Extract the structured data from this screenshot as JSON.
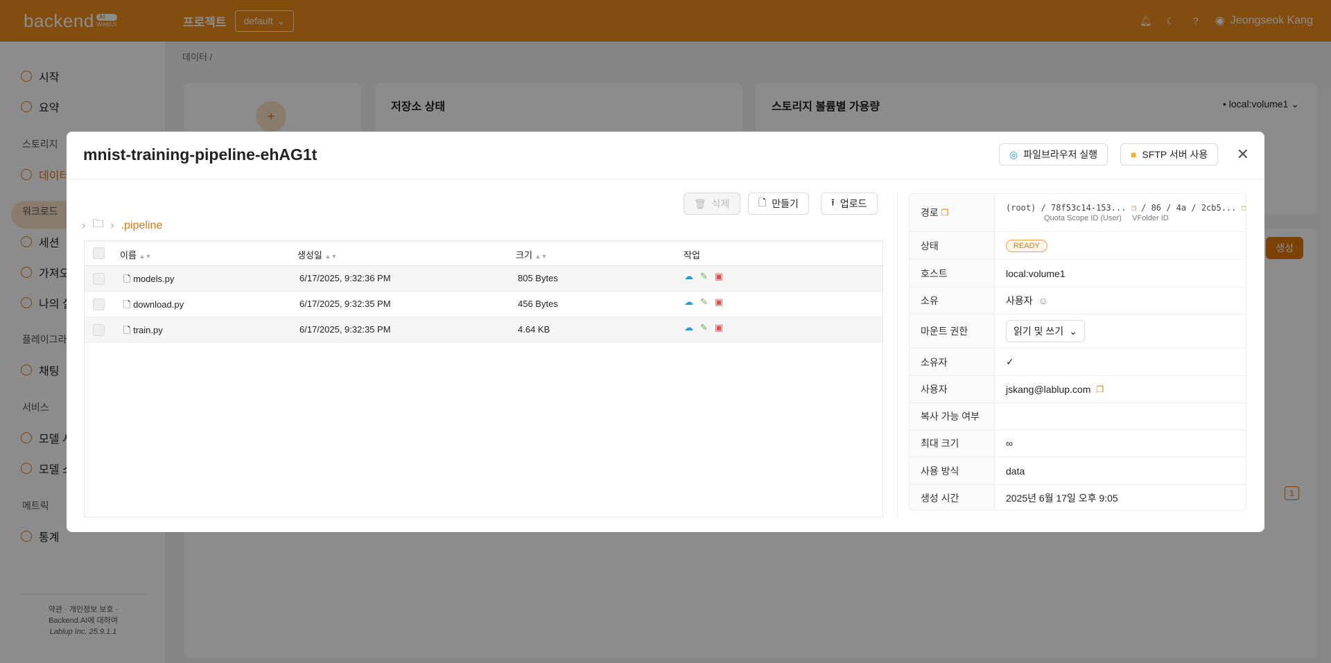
{
  "header": {
    "logo": "backend",
    "logo_ai": "AI",
    "logo_sub": "WebUI",
    "project_label": "프로젝트",
    "project_value": "default",
    "user_name": "Jeongseok Kang"
  },
  "sidebar": {
    "items": [
      {
        "label": "시작"
      },
      {
        "label": "요약"
      },
      {
        "label": "데이터"
      },
      {
        "label": "세션"
      },
      {
        "label": "가져오"
      },
      {
        "label": "나의 실"
      },
      {
        "label": "채팅"
      },
      {
        "label": "모델 서"
      },
      {
        "label": "모델 스"
      },
      {
        "label": "통계"
      }
    ],
    "sections": [
      "스토리지",
      "워크로드",
      "플레이그라",
      "서비스",
      "메트릭"
    ],
    "footer": {
      "line1": "약관 · 개인정보 보호 ·",
      "line2": "Backend.AI에 대하여",
      "line3": "Lablup Inc. 25.9.1.1"
    }
  },
  "main": {
    "breadcrumb": "데이터  /",
    "storage_status": "저장소 상태",
    "volume_title": "스토리지 볼륨별 가용량",
    "volume_sel": "local:volume1",
    "create_btn": "생성",
    "page": "1"
  },
  "modal": {
    "title": "mnist-training-pipeline-ehAG1t",
    "filebrowser_btn": "파일브라우저 실행",
    "sftp_btn": "SFTP 서버 사용",
    "toolbar": {
      "delete": "삭제",
      "create": "만들기",
      "upload": "업로드"
    },
    "path": ".pipeline",
    "columns": {
      "name": "이름",
      "created": "생성일",
      "size": "크기",
      "actions": "작업"
    },
    "files": [
      {
        "name": "models.py",
        "created": "6/17/2025, 9:32:36 PM",
        "size": "805 Bytes"
      },
      {
        "name": "download.py",
        "created": "6/17/2025, 9:32:35 PM",
        "size": "456 Bytes"
      },
      {
        "name": "train.py",
        "created": "6/17/2025, 9:32:35 PM",
        "size": "4.64 KB"
      }
    ],
    "info": {
      "path_label": "경로",
      "path_root": "(root)",
      "path_quota": "78f53c14-153...",
      "path_vf": "86 / 4a / 2cb5...",
      "quota_caption": "Quota Scope ID (User)",
      "vfolder_caption": "VFolder ID",
      "status_label": "상태",
      "status": "READY",
      "host_label": "호스트",
      "host": "local:volume1",
      "owner_label": "소유",
      "owner": "사용자",
      "mount_label": "마운트 권한",
      "mount": "읽기 및 쓰기",
      "ownership_label": "소유자",
      "user_label": "사용자",
      "user": "jskang@lablup.com",
      "cloneable_label": "복사 가능 여부",
      "maxsize_label": "최대 크기",
      "maxsize": "∞",
      "usage_label": "사용 방식",
      "usage": "data",
      "created_label": "생성 시간",
      "created": "2025년 6월 17일 오후 9:05"
    }
  },
  "colors": {
    "accent": "#f08c1e",
    "danger": "#d9534f",
    "upload": "#1e9fd6",
    "edit": "#6aa84f"
  }
}
